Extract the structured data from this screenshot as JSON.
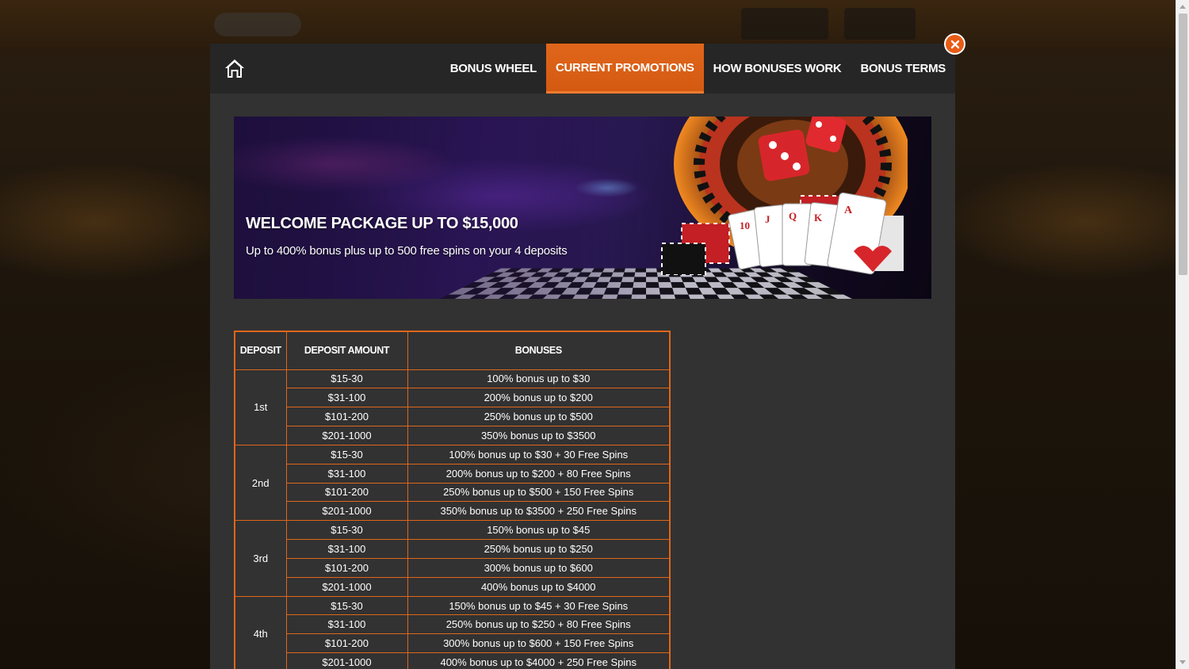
{
  "nav": {
    "tabs": [
      {
        "label": "BONUS WHEEL",
        "active": false
      },
      {
        "label": "CURRENT PROMOTIONS",
        "active": true
      },
      {
        "label": "HOW BONUSES WORK",
        "active": false
      },
      {
        "label": "BONUS TERMS",
        "active": false
      }
    ],
    "home_icon": "home-icon",
    "close_icon": "close-icon"
  },
  "banner": {
    "title": "WELCOME PACKAGE UP TO $15,000",
    "subtitle": "Up to 400% bonus plus up to 500 free spins on your 4 deposits",
    "card_labels": [
      "10",
      "J",
      "Q",
      "K",
      "A"
    ]
  },
  "table": {
    "headers": [
      "DEPOSIT",
      "DEPOSIT AMOUNT",
      "BONUSES"
    ],
    "groups": [
      {
        "deposit": "1st",
        "rows": [
          {
            "amount": "$15-30",
            "bonus": "100% bonus up to $30"
          },
          {
            "amount": "$31-100",
            "bonus": "200% bonus up to $200"
          },
          {
            "amount": "$101-200",
            "bonus": "250% bonus up to $500"
          },
          {
            "amount": "$201-1000",
            "bonus": "350% bonus up to $3500"
          }
        ]
      },
      {
        "deposit": "2nd",
        "rows": [
          {
            "amount": "$15-30",
            "bonus": "100% bonus up to $30 + 30 Free Spins"
          },
          {
            "amount": "$31-100",
            "bonus": "200% bonus up to $200 + 80 Free Spins"
          },
          {
            "amount": "$101-200",
            "bonus": "250% bonus up to $500 + 150 Free Spins"
          },
          {
            "amount": "$201-1000",
            "bonus": "350% bonus up to $3500 + 250 Free Spins"
          }
        ]
      },
      {
        "deposit": "3rd",
        "rows": [
          {
            "amount": "$15-30",
            "bonus": "150% bonus up to $45"
          },
          {
            "amount": "$31-100",
            "bonus": "250% bonus up to $250"
          },
          {
            "amount": "$101-200",
            "bonus": "300% bonus up to $600"
          },
          {
            "amount": "$201-1000",
            "bonus": "400% bonus up to $4000"
          }
        ]
      },
      {
        "deposit": "4th",
        "rows": [
          {
            "amount": "$15-30",
            "bonus": "150% bonus up to $45 + 30 Free Spins"
          },
          {
            "amount": "$31-100",
            "bonus": "250% bonus up to $250 + 80 Free Spins"
          },
          {
            "amount": "$101-200",
            "bonus": "300% bonus up to $600 + 150 Free Spins"
          },
          {
            "amount": "$201-1000",
            "bonus": "400% bonus up to $4000 + 250 Free Spins"
          }
        ]
      }
    ]
  },
  "colors": {
    "accent": "#e0661b",
    "modal_bg": "#323232",
    "nav_bg": "#262626"
  }
}
